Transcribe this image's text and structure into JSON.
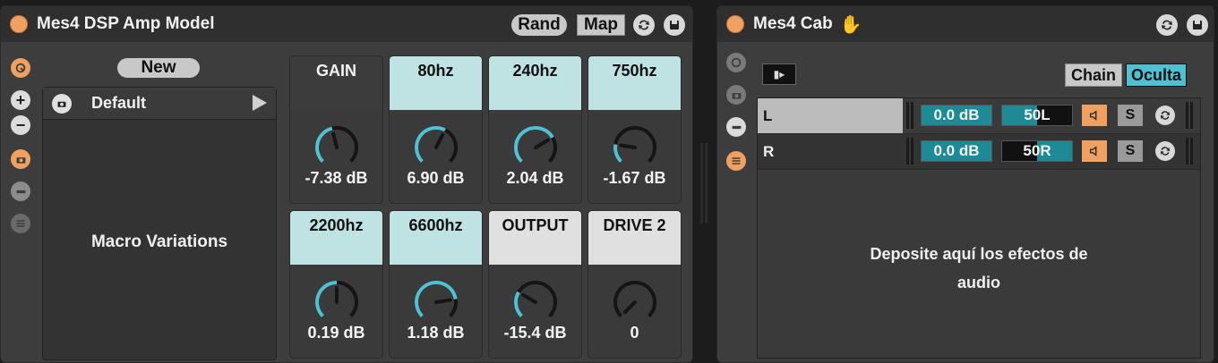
{
  "amp": {
    "title": "Mes4 DSP Amp Model",
    "rand_label": "Rand",
    "map_label": "Map",
    "new_label": "New",
    "preset_name": "Default",
    "macro_variations": "Macro Variations",
    "knobs": [
      {
        "label": "GAIN",
        "value": "-7.38 dB",
        "style": "gray",
        "level": 0.45
      },
      {
        "label": "80hz",
        "value": "6.90 dB",
        "style": "teal",
        "level": 0.6
      },
      {
        "label": "240hz",
        "value": "2.04 dB",
        "style": "teal",
        "level": 0.72
      },
      {
        "label": "750hz",
        "value": "-1.67 dB",
        "style": "teal",
        "level": 0.2
      },
      {
        "label": "2200hz",
        "value": "0.19 dB",
        "style": "teal",
        "level": 0.5
      },
      {
        "label": "6600hz",
        "value": "1.18 dB",
        "style": "teal",
        "level": 0.8
      },
      {
        "label": "OUTPUT",
        "value": "-15.4 dB",
        "style": "white",
        "level": 0.28
      },
      {
        "label": "DRIVE 2",
        "value": "0",
        "style": "white",
        "level": 0.0
      }
    ]
  },
  "cab": {
    "title": "Mes4 Cab",
    "chain_label": "Chain",
    "hide_label": "Oculta",
    "chains": [
      {
        "name": "L",
        "volume": "0.0 dB",
        "pan": "50L",
        "solo": "S"
      },
      {
        "name": "R",
        "volume": "0.0 dB",
        "pan": "50R",
        "solo": "S"
      }
    ],
    "drop_text_line1": "Deposite aquí los efectos de",
    "drop_text_line2": "audio"
  },
  "colors": {
    "accent_orange": "#f0a060",
    "teal": "#bfe3e2",
    "knob_arc": "#4fc1d3"
  }
}
